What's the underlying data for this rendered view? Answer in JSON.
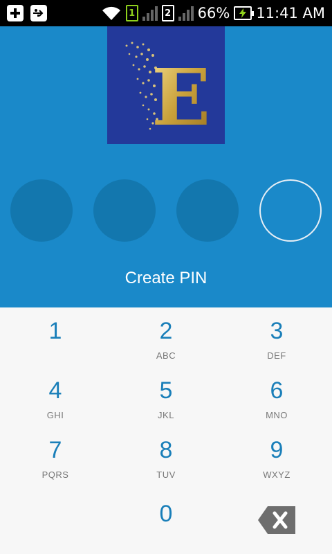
{
  "status_bar": {
    "sim1": "1",
    "sim2": "2",
    "battery": "66%",
    "time": "11:41 AM",
    "icons": [
      "add-icon",
      "usb-icon",
      "wifi-icon",
      "sim1-icon",
      "signal-icon",
      "sim2-icon",
      "signal-icon",
      "battery-charging-icon"
    ]
  },
  "logo": {
    "letter": "E"
  },
  "pin": {
    "total": 4,
    "filled": 0
  },
  "prompt": "Create PIN",
  "keypad": {
    "keys": [
      {
        "digit": "1",
        "letters": ""
      },
      {
        "digit": "2",
        "letters": "ABC"
      },
      {
        "digit": "3",
        "letters": "DEF"
      },
      {
        "digit": "4",
        "letters": "GHI"
      },
      {
        "digit": "5",
        "letters": "JKL"
      },
      {
        "digit": "6",
        "letters": "MNO"
      },
      {
        "digit": "7",
        "letters": "PQRS"
      },
      {
        "digit": "8",
        "letters": "TUV"
      },
      {
        "digit": "9",
        "letters": "WXYZ"
      },
      {
        "digit": "0",
        "letters": ""
      }
    ],
    "backspace_icon": "backspace-icon"
  },
  "colors": {
    "header": "#1a89c9",
    "pin_dot": "#1377ae",
    "digit": "#1a7fb9",
    "logo_bg": "#23399a",
    "logo_gold": "#c9a13b"
  }
}
